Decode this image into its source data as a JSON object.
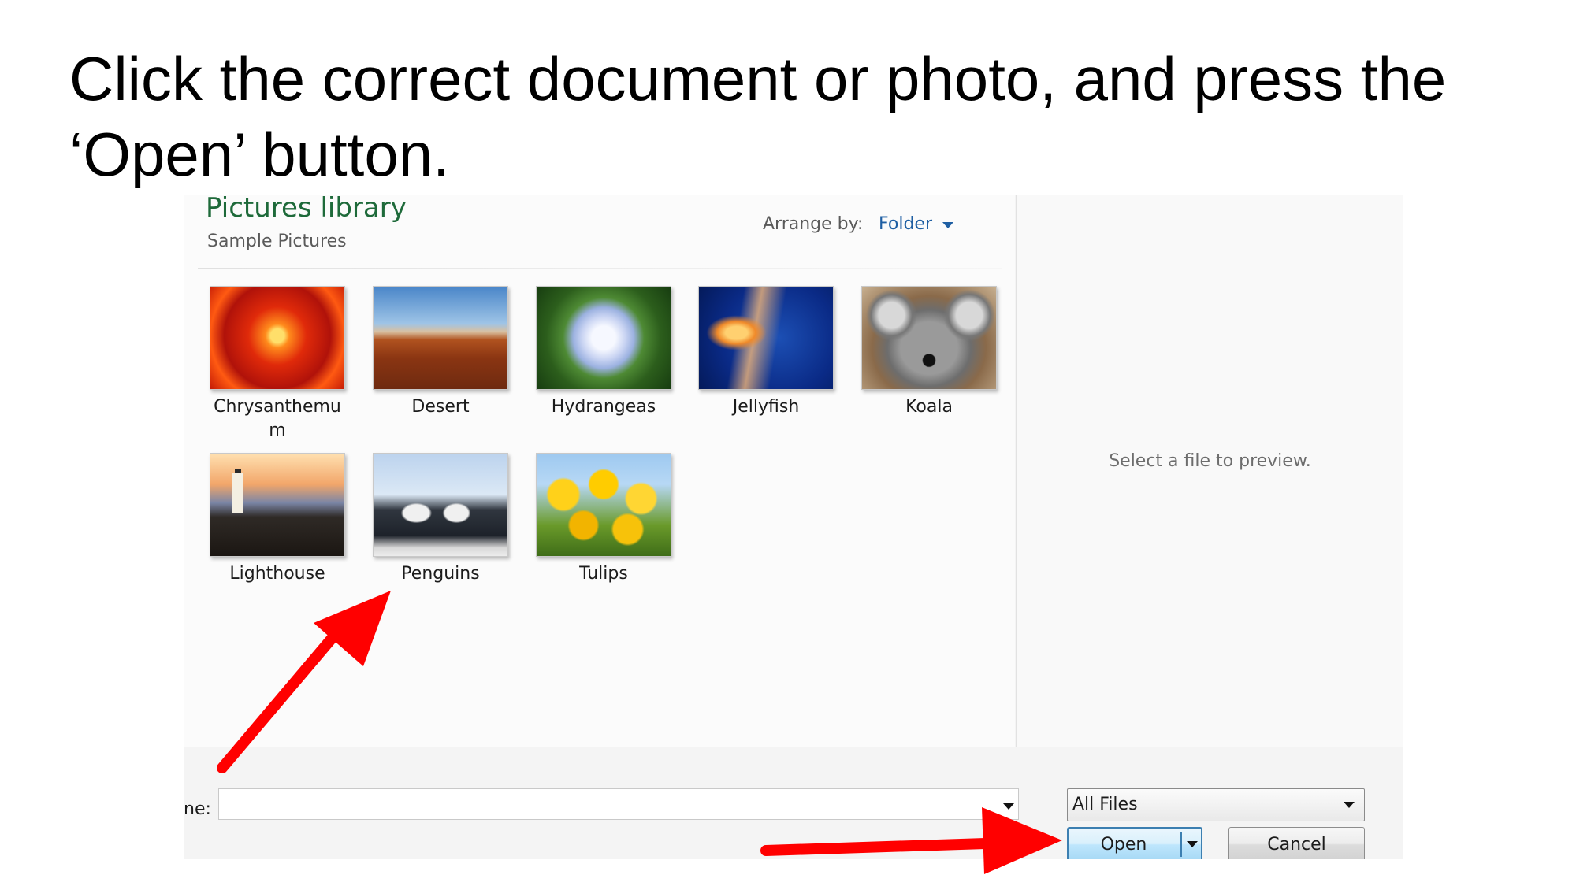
{
  "instruction": {
    "line1": "Click the correct document or photo, and press the",
    "line2": "‘Open’ button."
  },
  "dialog": {
    "library_title": "Pictures library",
    "library_subtitle": "Sample Pictures",
    "arrange_label": "Arrange by:",
    "arrange_value": "Folder",
    "files": [
      {
        "name": "Chrysanthemu",
        "name_wrap": "m",
        "thumbnail": "red-flower"
      },
      {
        "name": "Desert",
        "thumbnail": "desert-butte"
      },
      {
        "name": "Hydrangeas",
        "thumbnail": "white-hydrangea"
      },
      {
        "name": "Jellyfish",
        "thumbnail": "orange-jellyfish"
      },
      {
        "name": "Koala",
        "thumbnail": "koala"
      },
      {
        "name": "Lighthouse",
        "thumbnail": "lighthouse-sunset"
      },
      {
        "name": "Penguins",
        "thumbnail": "penguins"
      },
      {
        "name": "Tulips",
        "thumbnail": "yellow-tulips"
      }
    ],
    "preview_text": "Select a file to preview.",
    "file_name_label": "ne:",
    "file_name_value": "",
    "file_type_filter": "All Files",
    "open_button": "Open",
    "cancel_button": "Cancel"
  },
  "annotation_arrows": {
    "color": "#ff0000",
    "targets": [
      "penguins-thumbnail",
      "open-button"
    ]
  }
}
